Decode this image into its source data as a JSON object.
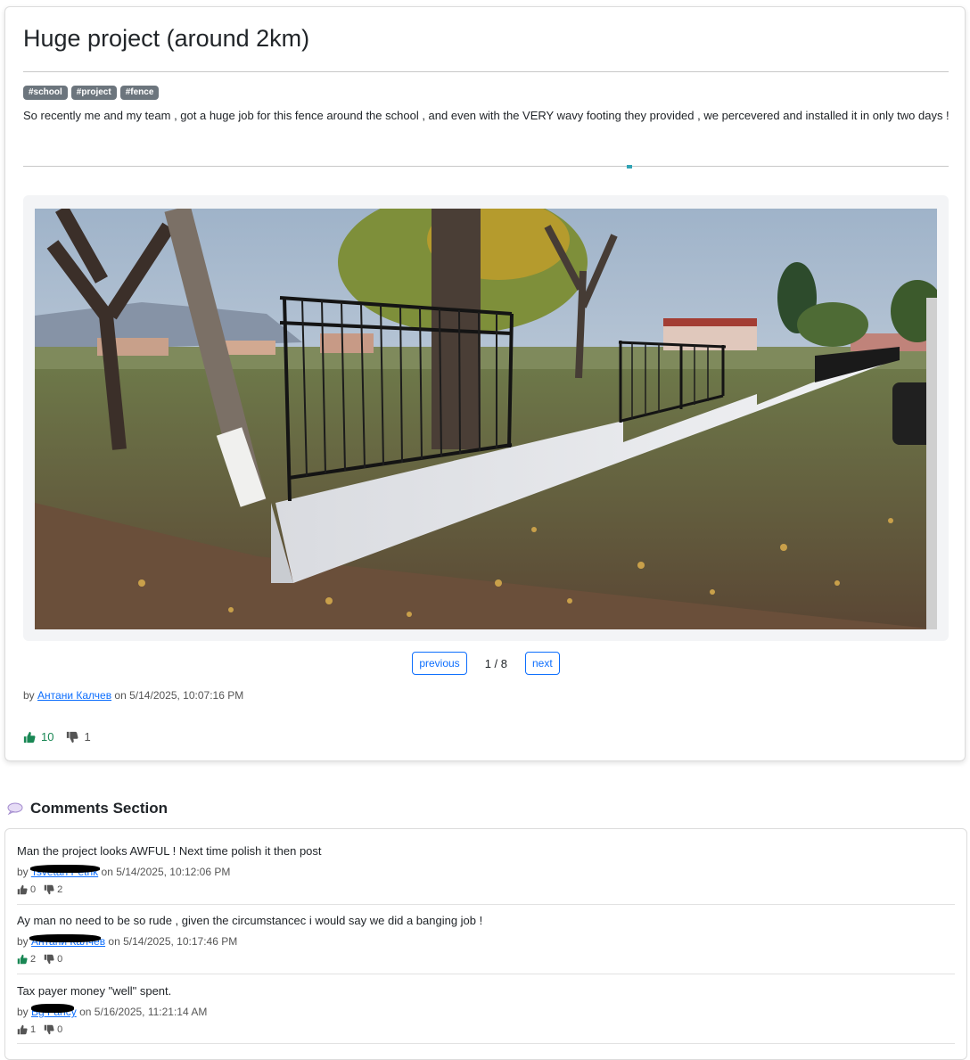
{
  "post": {
    "title": "Huge project (around 2km)",
    "tags": [
      "#school",
      "#project",
      "#fence"
    ],
    "body": "So recently me and my team , got a huge job for this fence around the school , and even with the VERY wavy footing they provided , we percevered and installed it in only two days !",
    "pager": {
      "previous_label": "previous",
      "count": "1 / 8",
      "next_label": "next"
    },
    "byline": {
      "prefix": "by",
      "author": "Антани Калчев",
      "on": "on",
      "date": "5/14/2025, 10:07:16 PM"
    },
    "likes": "10",
    "dislikes": "1",
    "colors": {
      "like": "#198754",
      "link": "#0d6efd",
      "tag_bg": "#6c757d"
    }
  },
  "comments": {
    "title": "Comments Section",
    "items": [
      {
        "text": "Man the project looks AWFUL ! Next time polish it then post",
        "prefix": "by",
        "author": "Tsvetan Petrik",
        "on": "on",
        "date": "5/14/2025, 10:12:06 PM",
        "likes": "0",
        "dislikes": "2"
      },
      {
        "text": "Ay man no need to be so rude , given the circumstancec i would say we did a banging job !",
        "prefix": "by",
        "author": "Антани Калчев",
        "on": "on",
        "date": "5/14/2025, 10:17:46 PM",
        "likes": "2",
        "dislikes": "0"
      },
      {
        "text": "Tax payer money \"well\" spent.",
        "prefix": "by",
        "author": "Bg Fancy",
        "on": "on",
        "date": "5/16/2025, 11:21:14 AM",
        "likes": "1",
        "dislikes": "0"
      }
    ]
  }
}
